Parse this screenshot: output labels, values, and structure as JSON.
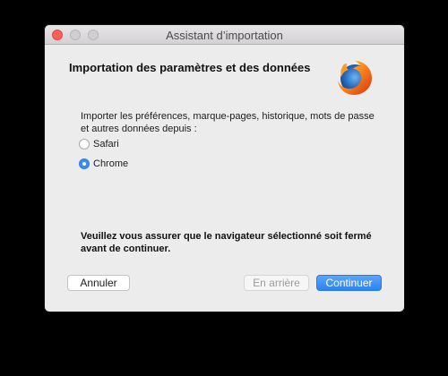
{
  "window": {
    "title": "Assistant d’importation"
  },
  "dialog": {
    "heading": "Importation des paramètres et des données",
    "logo_icon": "firefox-logo-icon",
    "instructions": "Importer les préférences, marque-pages, historique, mots de passe et autres données depuis :",
    "options": [
      {
        "label": "Safari",
        "selected": false
      },
      {
        "label": "Chrome",
        "selected": true
      }
    ],
    "warning": "Veuillez vous assurer que le navigateur sélectionné soit fermé avant de continuer."
  },
  "buttons": {
    "cancel": "Annuler",
    "back": "En arrière",
    "continue": "Continuer"
  },
  "colors": {
    "accent": "#3a8df5",
    "close_button": "#fc5f57"
  }
}
